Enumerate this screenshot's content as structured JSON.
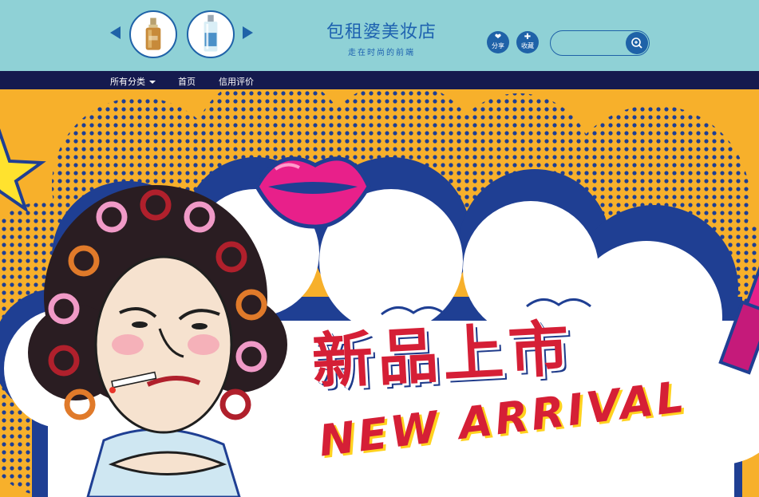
{
  "shop": {
    "name": "包租婆美妆店",
    "slogan": "走在时尚的前端"
  },
  "header": {
    "share": {
      "icon": "heart-icon",
      "label": "分享"
    },
    "collect": {
      "icon": "plus-icon",
      "label": "收藏"
    },
    "search": {
      "placeholder": "",
      "icon": "search-icon"
    },
    "carousel": {
      "prev_icon": "arrow-left-icon",
      "next_icon": "arrow-right-icon",
      "items": [
        "serum-bottle",
        "lotion-bottle"
      ]
    }
  },
  "nav": {
    "all_categories": "所有分类",
    "home": "首页",
    "reviews": "信用评价"
  },
  "banner": {
    "headline": "新品上市",
    "subline": "NEW ARRIVAL"
  },
  "colors": {
    "header_bg": "#8fd1d6",
    "accent_blue": "#1f62a8",
    "nav_bg": "#151a4e",
    "banner_orange": "#f7b02b",
    "headline_red": "#d51f36"
  }
}
